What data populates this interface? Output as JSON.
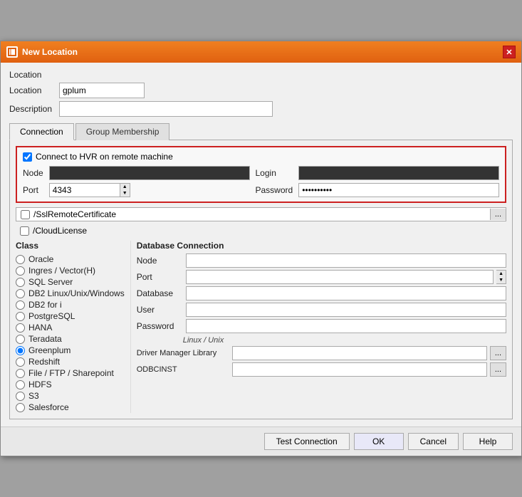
{
  "titleBar": {
    "title": "New Location",
    "closeLabel": "✕"
  },
  "location": {
    "locationLabel": "Location",
    "locationValue": "gplum",
    "descriptionLabel": "Description",
    "descriptionValue": ""
  },
  "tabs": {
    "connection": "Connection",
    "groupMembership": "Group Membership"
  },
  "remoteSection": {
    "checkboxLabel": "Connect to HVR on remote machine",
    "nodeLabel": "Node",
    "loginLabel": "Login",
    "portLabel": "Port",
    "portValue": "4343",
    "passwordLabel": "Password",
    "passwordValue": "••••••••••"
  },
  "sslRow": {
    "checkboxChecked": false,
    "label": "/SslRemoteCertificate",
    "browseLabel": "..."
  },
  "cloudLicenseRow": {
    "checkboxChecked": false,
    "label": "/CloudLicense"
  },
  "classPanel": {
    "title": "Class",
    "items": [
      {
        "label": "Oracle",
        "selected": false
      },
      {
        "label": "Ingres / Vector(H)",
        "selected": false
      },
      {
        "label": "SQL Server",
        "selected": false
      },
      {
        "label": "DB2 Linux/Unix/Windows",
        "selected": false
      },
      {
        "label": "DB2 for i",
        "selected": false
      },
      {
        "label": "PostgreSQL",
        "selected": false
      },
      {
        "label": "HANA",
        "selected": false
      },
      {
        "label": "Teradata",
        "selected": false
      },
      {
        "label": "Greenplum",
        "selected": true
      },
      {
        "label": "Redshift",
        "selected": false
      },
      {
        "label": "File / FTP / Sharepoint",
        "selected": false
      },
      {
        "label": "HDFS",
        "selected": false
      },
      {
        "label": "S3",
        "selected": false
      },
      {
        "label": "Salesforce",
        "selected": false
      }
    ]
  },
  "dbPanel": {
    "title": "Database Connection",
    "nodeLabel": "Node",
    "nodeValue": "",
    "portLabel": "Port",
    "portValue": "",
    "databaseLabel": "Database",
    "databaseValue": "",
    "userLabel": "User",
    "userValue": "",
    "passwordLabel": "Password",
    "passwordValue": "",
    "linuxUnixLabel": "Linux / Unix",
    "driverManagerLabel": "Driver Manager Library",
    "driverManagerValue": "",
    "odbcinstLabel": "ODBCINST",
    "odbcinstValue": "",
    "browseLabel": "..."
  },
  "footer": {
    "testConnection": "Test Connection",
    "ok": "OK",
    "cancel": "Cancel",
    "help": "Help"
  }
}
